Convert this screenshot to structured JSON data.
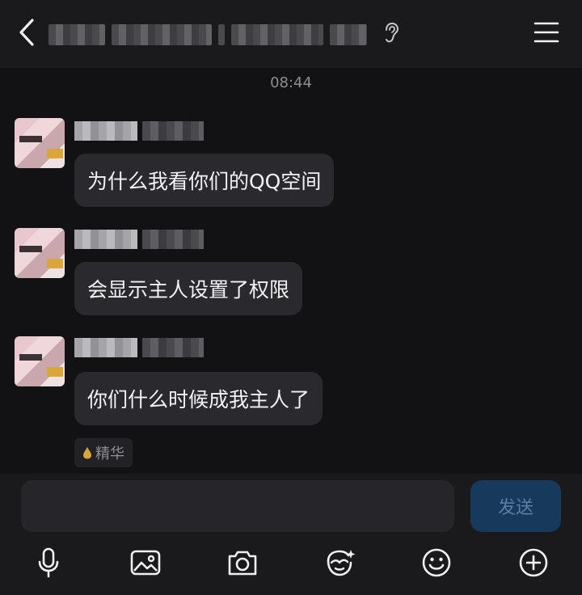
{
  "header": {
    "title": "",
    "back_icon": "chevron-left-icon",
    "ear_icon": "ear-icon",
    "menu_icon": "menu-icon"
  },
  "timestamp": "08:44",
  "messages": [
    {
      "text": "为什么我看你们的QQ空间"
    },
    {
      "text": "会显示主人设置了权限"
    },
    {
      "text": "你们什么时候成我主人了"
    }
  ],
  "badge": {
    "label": "精华",
    "icon": "drop-icon",
    "color": "#d9a63b"
  },
  "composer": {
    "input_value": "",
    "input_placeholder": "",
    "send_label": "发送"
  },
  "toolbar": {
    "items": [
      "microphone-icon",
      "image-icon",
      "camera-icon",
      "face-sticker-icon",
      "emoji-icon",
      "plus-icon"
    ]
  },
  "colors": {
    "background": "#121214",
    "bubble": "#2a2a2e",
    "send_button": "#17395c",
    "send_text": "#5a7ea6"
  }
}
